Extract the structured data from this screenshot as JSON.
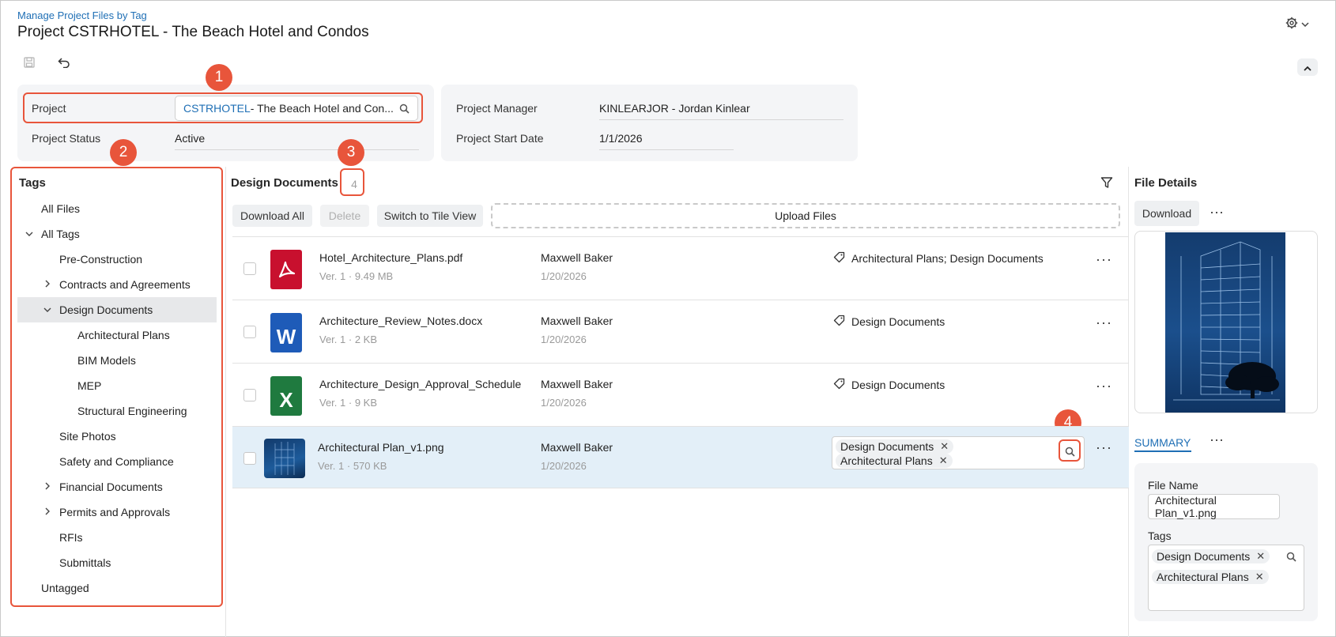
{
  "header": {
    "breadcrumb": "Manage Project Files by Tag",
    "title": "Project CSTRHOTEL - The Beach Hotel and Condos"
  },
  "summary": {
    "project_label": "Project",
    "project_code": "CSTRHOTEL",
    "project_name": " - The Beach Hotel and Con...",
    "status_label": "Project Status",
    "status_value": "Active",
    "manager_label": "Project Manager",
    "manager_value": "KINLEARJOR - Jordan Kinlear",
    "start_label": "Project Start Date",
    "start_value": "1/1/2026"
  },
  "annotations": [
    "1",
    "2",
    "3",
    "4"
  ],
  "tags_panel": {
    "title": "Tags",
    "items": [
      {
        "label": "All Files"
      },
      {
        "label": "All Tags"
      },
      {
        "label": "Pre-Construction"
      },
      {
        "label": "Contracts and Agreements"
      },
      {
        "label": "Design Documents"
      },
      {
        "label": "Architectural Plans"
      },
      {
        "label": "BIM Models"
      },
      {
        "label": "MEP"
      },
      {
        "label": "Structural Engineering"
      },
      {
        "label": "Site Photos"
      },
      {
        "label": "Safety and Compliance"
      },
      {
        "label": "Financial Documents"
      },
      {
        "label": "Permits and Approvals"
      },
      {
        "label": "RFIs"
      },
      {
        "label": "Submittals"
      },
      {
        "label": "Untagged"
      }
    ]
  },
  "files_panel": {
    "title": "Design Documents",
    "count": "4",
    "download_all": "Download All",
    "delete": "Delete",
    "switch_view": "Switch to Tile View",
    "upload": "Upload Files",
    "rows": [
      {
        "name": "Hotel_Architecture_Plans.pdf",
        "version": "Ver. 1",
        "size": "9.49 MB",
        "owner": "Maxwell Baker",
        "date": "1/20/2026",
        "tags": "Architectural Plans; Design Documents",
        "icon": "pdf-icon",
        "color": "#c8102e"
      },
      {
        "name": "Architecture_Review_Notes.docx",
        "version": "Ver. 1",
        "size": "2 KB",
        "owner": "Maxwell Baker",
        "date": "1/20/2026",
        "tags": "Design Documents",
        "icon": "word-icon",
        "color": "#1e5bb8"
      },
      {
        "name": "Architecture_Design_Approval_Schedule",
        "version": "Ver. 1",
        "size": "9 KB",
        "owner": "Maxwell Baker",
        "date": "1/20/2026",
        "tags": "Design Documents",
        "icon": "excel-icon",
        "color": "#1f7a3f"
      },
      {
        "name": "Architectural Plan_v1.png",
        "version": "Ver. 1",
        "size": "570 KB",
        "owner": "Maxwell Baker",
        "date": "1/20/2026",
        "tag_chips": [
          "Design Documents",
          "Architectural Plans"
        ],
        "icon": "image-thumbnail"
      }
    ]
  },
  "details": {
    "title": "File Details",
    "download": "Download",
    "summary_tab": "SUMMARY",
    "file_name_label": "File Name",
    "file_name_value": "Architectural Plan_v1.png",
    "tags_label": "Tags",
    "tags": [
      "Design Documents",
      "Architectural Plans"
    ]
  },
  "colors": {
    "accent": "#1f6fb5",
    "annotation": "#e8553b",
    "selected_row": "#e3eff8"
  }
}
